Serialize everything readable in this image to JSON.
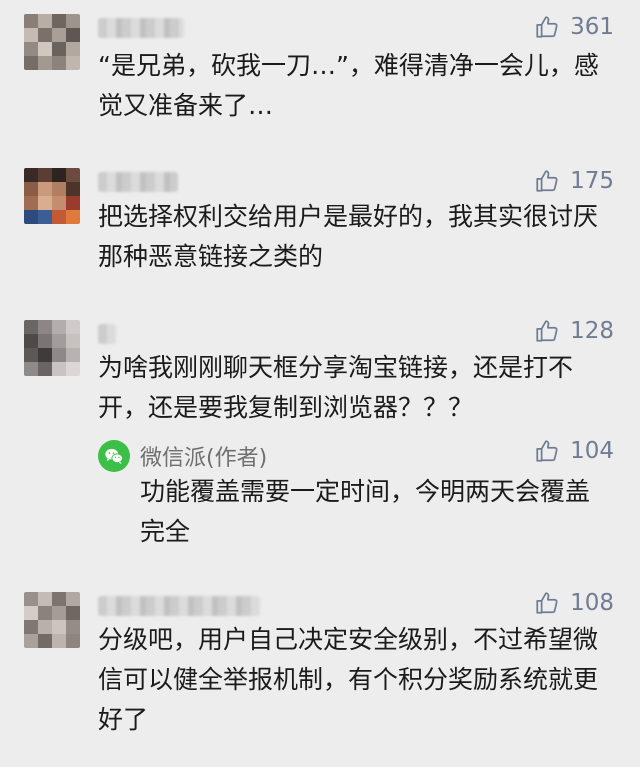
{
  "comments": [
    {
      "likes": "361",
      "text": "“是兄弟，砍我一刀…”，难得清净一会儿，感觉又准备来了…"
    },
    {
      "likes": "175",
      "text": "把选择权利交给用户是最好的，我其实很讨厌那种恶意链接之类的"
    },
    {
      "likes": "128",
      "text": "为啥我刚刚聊天框分享淘宝链接，还是打不开，还是要我复制到浏览器？？？",
      "reply": {
        "author": "微信派(作者)",
        "likes": "104",
        "text": "功能覆盖需要一定时间，今明两天会覆盖完全"
      }
    },
    {
      "likes": "108",
      "text": "分级吧，用户自己决定安全级别，不过希望微信可以健全举报机制，有个积分奖励系统就更好了"
    }
  ],
  "icons": {
    "like": "thumbs-up-icon",
    "wechat": "wechat-logo-icon"
  },
  "colors": {
    "background": "#ededed",
    "like_text": "#6f7c93",
    "wechat_green": "#3cbf46"
  }
}
